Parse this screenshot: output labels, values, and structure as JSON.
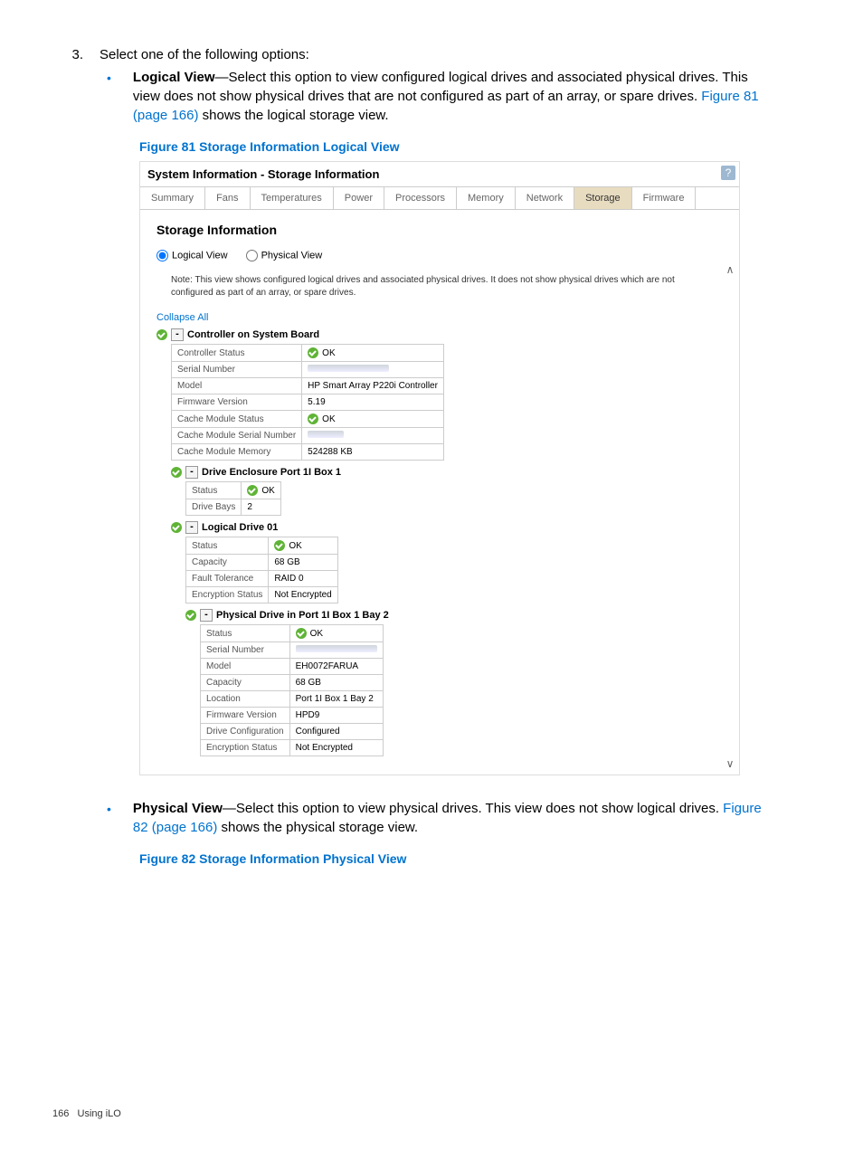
{
  "step": {
    "num": "3.",
    "text": "Select one of the following options:"
  },
  "bullet1": {
    "title": "Logical View",
    "body": "—Select this option to view configured logical drives and associated physical drives. This view does not show physical drives that are not configured as part of an array, or spare drives. ",
    "link": "Figure 81 (page 166)",
    "after": " shows the logical storage view."
  },
  "figure81": "Figure 81 Storage Information Logical View",
  "panel": {
    "title": "System Information - Storage Information",
    "help": "?",
    "tabs": [
      "Summary",
      "Fans",
      "Temperatures",
      "Power",
      "Processors",
      "Memory",
      "Network",
      "Storage",
      "Firmware"
    ],
    "activeTab": 7,
    "section": "Storage Information",
    "radioLogical": "Logical View",
    "radioPhysical": "Physical View",
    "note": "Note: This view shows configured logical drives and associated physical drives. It does not show physical drives which are not configured as part of an array, or spare drives.",
    "collapse": "Collapse All"
  },
  "controller": {
    "hdr": "Controller on System Board",
    "rows": [
      [
        "Controller Status",
        "__OK__"
      ],
      [
        "Serial Number",
        "__REDACT__"
      ],
      [
        "Model",
        "HP Smart Array P220i Controller"
      ],
      [
        "Firmware Version",
        "5.19"
      ],
      [
        "Cache Module Status",
        "__OK__"
      ],
      [
        "Cache Module Serial Number",
        "__REDACTS__"
      ],
      [
        "Cache Module Memory",
        "524288 KB"
      ]
    ]
  },
  "enclosure": {
    "hdr": "Drive Enclosure Port 1I Box 1",
    "rows": [
      [
        "Status",
        "__OK__"
      ],
      [
        "Drive Bays",
        "2"
      ]
    ]
  },
  "logical": {
    "hdr": "Logical Drive 01",
    "rows": [
      [
        "Status",
        "__OK__"
      ],
      [
        "Capacity",
        "68 GB"
      ],
      [
        "Fault Tolerance",
        "RAID 0"
      ],
      [
        "Encryption Status",
        "Not Encrypted"
      ]
    ]
  },
  "physical": {
    "hdr": "Physical Drive in Port 1I Box 1 Bay 2",
    "rows": [
      [
        "Status",
        "__OK__"
      ],
      [
        "Serial Number",
        "__REDACT__"
      ],
      [
        "Model",
        "EH0072FARUA"
      ],
      [
        "Capacity",
        "68 GB"
      ],
      [
        "Location",
        "Port 1I Box 1 Bay 2"
      ],
      [
        "Firmware Version",
        "HPD9"
      ],
      [
        "Drive Configuration",
        "Configured"
      ],
      [
        "Encryption Status",
        "Not Encrypted"
      ]
    ]
  },
  "ok": "OK",
  "bullet2": {
    "title": "Physical View",
    "body": "—Select this option to view physical drives. This view does not show logical drives. ",
    "link": "Figure 82 (page 166)",
    "after": " shows the physical storage view."
  },
  "figure82": "Figure 82 Storage Information Physical View",
  "footer": {
    "page": "166",
    "section": "Using iLO"
  }
}
